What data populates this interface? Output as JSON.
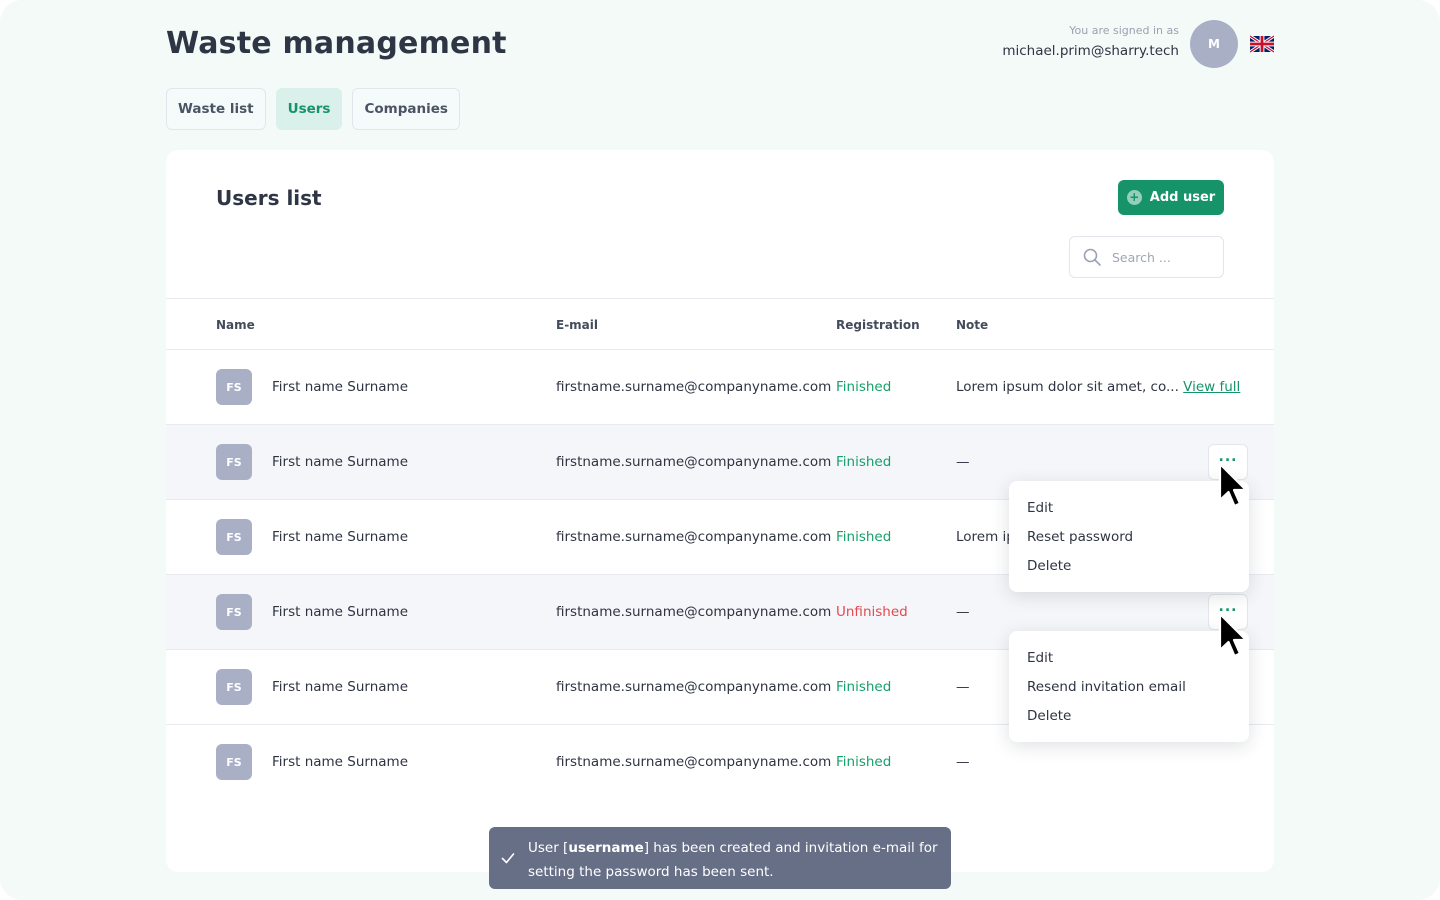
{
  "app": {
    "title": "Waste management"
  },
  "user": {
    "signed_in_label": "You are signed in as",
    "email": "michael.prim@sharry.tech",
    "avatar_initial": "M",
    "language_icon": "uk-flag-icon"
  },
  "tabs": [
    {
      "label": "Waste list",
      "active": false
    },
    {
      "label": "Users",
      "active": true
    },
    {
      "label": "Companies",
      "active": false
    }
  ],
  "users_list": {
    "title": "Users list",
    "add_button": "Add user",
    "search_placeholder": "Search ...",
    "columns": {
      "name": "Name",
      "email": "E-mail",
      "registration": "Registration",
      "note": "Note"
    },
    "rows": [
      {
        "initials": "FS",
        "name": "First name Surname",
        "email": "firstname.surname@companyname.com",
        "registration": "Finished",
        "note": "Lorem ipsum dolor sit amet, co...",
        "view_full": "View full"
      },
      {
        "initials": "FS",
        "name": "First name Surname",
        "email": "firstname.surname@companyname.com",
        "registration": "Finished",
        "note": "—",
        "more": "..."
      },
      {
        "initials": "FS",
        "name": "First name Surname",
        "email": "firstname.surname@companyname.com",
        "registration": "Finished",
        "note": "Lorem ip"
      },
      {
        "initials": "FS",
        "name": "First name Surname",
        "email": "firstname.surname@companyname.com",
        "registration": "Unfinished",
        "note": "—",
        "more": "..."
      },
      {
        "initials": "FS",
        "name": "First name Surname",
        "email": "firstname.surname@companyname.com",
        "registration": "Finished",
        "note": "—"
      },
      {
        "initials": "FS",
        "name": "First name Surname",
        "email": "firstname.surname@companyname.com",
        "registration": "Finished",
        "note": "—"
      }
    ]
  },
  "menus": {
    "finished_user": [
      "Edit",
      "Reset password",
      "Delete"
    ],
    "unfinished_user": [
      "Edit",
      "Resend invitation email",
      "Delete"
    ]
  },
  "toast": {
    "prefix": "User [",
    "username": "username",
    "suffix": "] has been created and invitation e-mail for setting the password has been sent."
  },
  "colors": {
    "accent": "#17936a",
    "finished": "#16a06b",
    "unfinished": "#e2494f",
    "toast_bg": "#676f87",
    "page_bg": "#f3faf8"
  }
}
